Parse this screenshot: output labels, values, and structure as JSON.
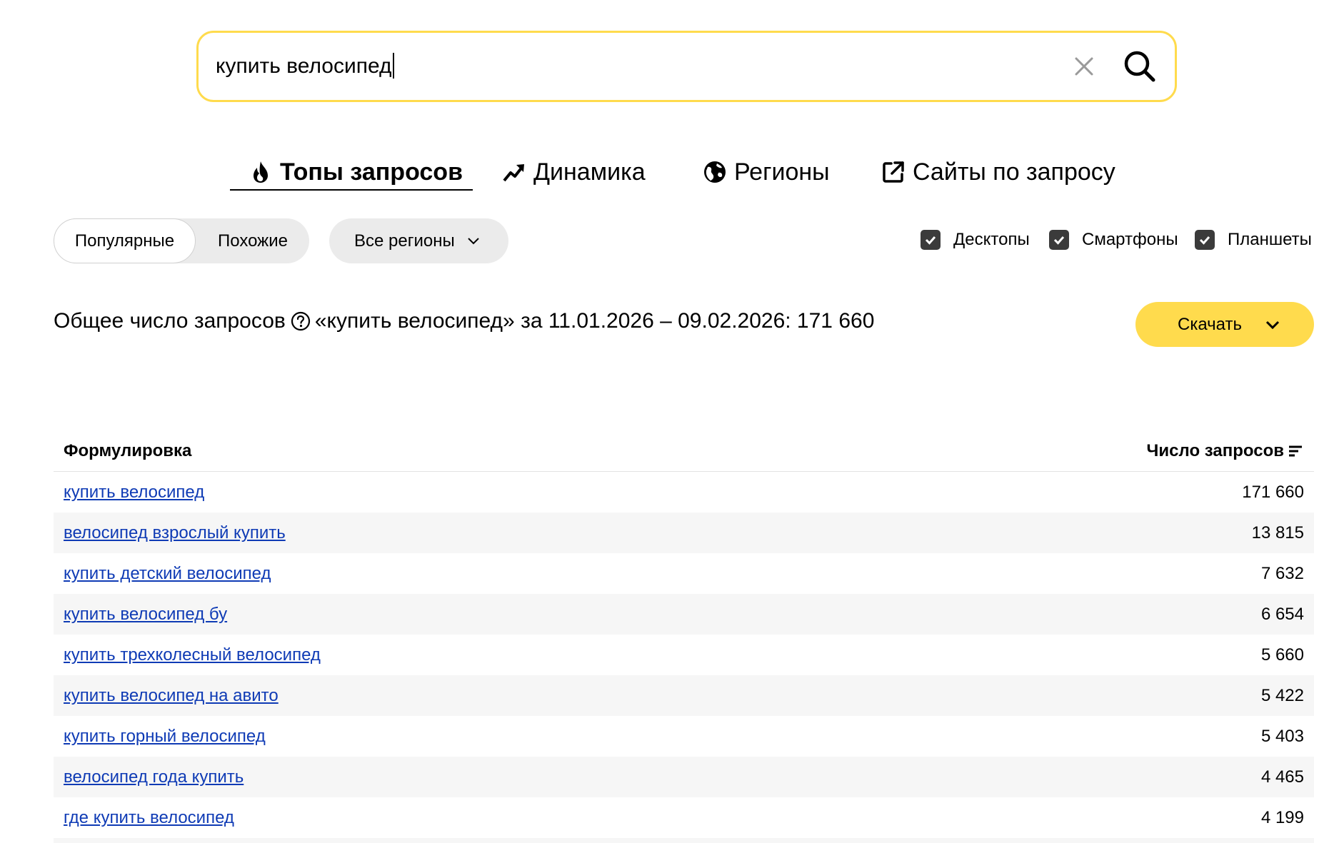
{
  "search": {
    "value": "купить велосипед"
  },
  "tabs": [
    {
      "label": "Топы запросов",
      "icon": "fire-icon",
      "active": true
    },
    {
      "label": "Динамика",
      "icon": "trend-up-icon"
    },
    {
      "label": "Регионы",
      "icon": "globe-icon"
    },
    {
      "label": "Сайты по запросу",
      "icon": "external-link-icon"
    }
  ],
  "filters": {
    "popular_label": "Популярные",
    "similar_label": "Похожие",
    "regions_label": "Все регионы",
    "devices": [
      {
        "label": "Десктопы",
        "checked": true
      },
      {
        "label": "Смартфоны",
        "checked": true
      },
      {
        "label": "Планшеты",
        "checked": true
      }
    ]
  },
  "total": {
    "prefix": "Общее число запросов",
    "suffix": "«купить велосипед» за 11.01.2026 – 09.02.2026: 171 660"
  },
  "download_label": "Скачать",
  "table": {
    "col_phrase": "Формулировка",
    "col_count": "Число запросов",
    "rows": [
      {
        "phrase": "купить велосипед",
        "count": "171 660"
      },
      {
        "phrase": "велосипед взрослый купить",
        "count": "13 815"
      },
      {
        "phrase": "купить детский велосипед",
        "count": "7 632"
      },
      {
        "phrase": "купить велосипед бу",
        "count": "6 654"
      },
      {
        "phrase": "купить трехколесный велосипед",
        "count": "5 660"
      },
      {
        "phrase": "купить велосипед на авито",
        "count": "5 422"
      },
      {
        "phrase": "купить горный велосипед",
        "count": "5 403"
      },
      {
        "phrase": "велосипед года купить",
        "count": "4 465"
      },
      {
        "phrase": "где купить велосипед",
        "count": "4 199"
      }
    ]
  },
  "colors": {
    "accent": "#ffdb4d",
    "link": "#0f3bb5",
    "row_alt": "#f6f6f6"
  }
}
